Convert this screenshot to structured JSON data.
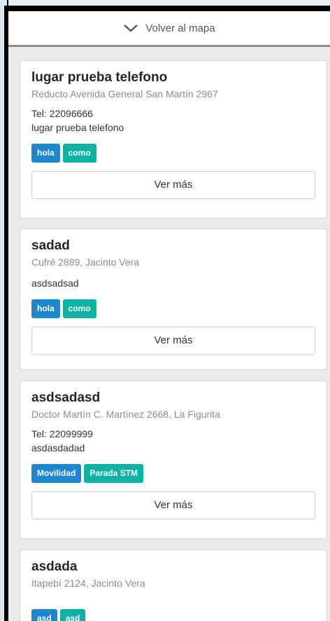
{
  "header": {
    "back_label": "Volver al mapa"
  },
  "colors": {
    "blue_tag": "#1c86cf",
    "teal_tag": "#0fb3a6"
  },
  "places": [
    {
      "title": "lugar prueba telefono",
      "address": "Reducto Avenida General San Martín 2967",
      "phone": "Tel: 22096666",
      "description": "lugar prueba telefono",
      "tags": [
        "hola",
        "como"
      ],
      "more_label": "Ver más"
    },
    {
      "title": "sadad",
      "address": "Cufré 2889, Jacinto Vera",
      "phone": "",
      "description": "asdsadsad",
      "tags": [
        "hola",
        "como"
      ],
      "more_label": "Ver más"
    },
    {
      "title": "asdsadasd",
      "address": "Doctor Martín C. Martínez 2668, La Figurita",
      "phone": "Tel: 22099999",
      "description": "asdasdadad",
      "tags": [
        "Movilidad",
        "Parada STM"
      ],
      "more_label": "Ver más"
    },
    {
      "title": "asdada",
      "address": "Itapebí 2124, Jacinto Vera",
      "phone": "",
      "description": "",
      "tags": [
        "asd",
        "asd"
      ],
      "more_label": ""
    }
  ]
}
